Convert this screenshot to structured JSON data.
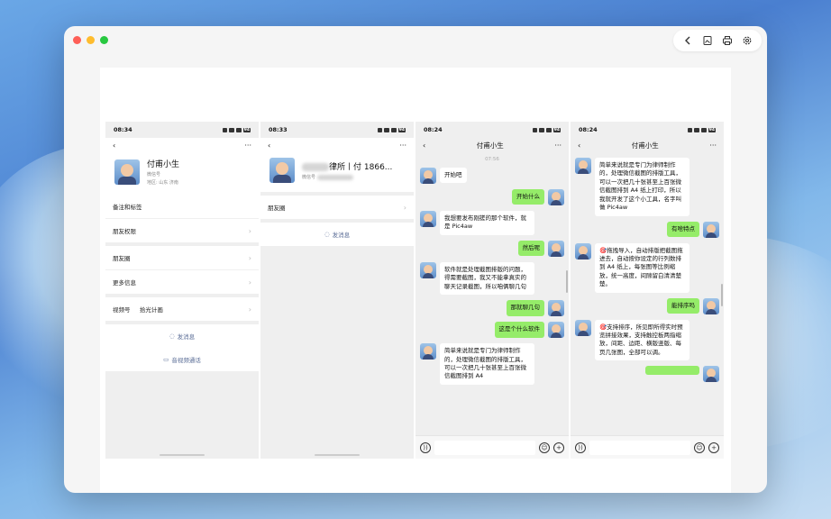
{
  "window": {
    "toolbar_icons": [
      "back-icon",
      "image-icon",
      "print-icon",
      "settings-icon"
    ]
  },
  "phones": [
    {
      "time": "08:34",
      "battery": "94",
      "name": "付甫小生",
      "wechat_id_label": "微信号",
      "region_label": "地区: 山东 济南",
      "rows": [
        "备注和标签",
        "朋友权限",
        "朋友圈",
        "更多信息"
      ],
      "channel_label": "视频号",
      "channel_value": "拾光计画",
      "send_message": "发消息",
      "video_call": "音视频通话"
    },
    {
      "time": "08:33",
      "battery": "94",
      "name_visible": "律所丨付",
      "name_suffix": "1866...",
      "wechat_id_label": "微信号",
      "moments": "朋友圈",
      "send_message": "发消息"
    },
    {
      "time": "08:24",
      "battery": "94",
      "title": "付甫小生",
      "timestamp": "07:56",
      "messages": [
        {
          "side": "left",
          "text": "开始吧"
        },
        {
          "side": "right",
          "text": "开始什么"
        },
        {
          "side": "left",
          "text": "我想要发布刚搓的那个软件，就是 Pic4aw"
        },
        {
          "side": "right",
          "text": "然后呢"
        },
        {
          "side": "left",
          "text": "软件就是处理截图排版的问题，得需要截图，我又不能拿真实的聊天记录截图，所以咱俩聊几句"
        },
        {
          "side": "right",
          "text": "那就聊几句"
        },
        {
          "side": "right",
          "text": "这是个什么软件"
        },
        {
          "side": "left",
          "text": "简单来说就是专门为律师制作的，处理微信截图的排版工具，可以一次把几十张甚至上百张微信截图排到 A4"
        }
      ]
    },
    {
      "time": "08:24",
      "battery": "94",
      "title": "付甫小生",
      "messages": [
        {
          "side": "left",
          "text": "简单来说就是专门为律师制作的，处理微信截图的排版工具，可以一次把几十张甚至上百张微信截图排到 A4 纸上打印，所以我就开发了这个小工具，名字叫做 Pic4aw"
        },
        {
          "side": "right",
          "text": "有啥特点"
        },
        {
          "side": "left",
          "text": "🎯拖拽导入，自动排版把截图拖进去，自动按你设定的行列数排到 A4 纸上，每张图等比例缩放，统一高度，间隙留白清清楚楚。"
        },
        {
          "side": "right",
          "text": "能排序吗"
        },
        {
          "side": "left",
          "text": "🎯支持排序，所见即所得实时预览拼接效果，支持触控板两指缩放，间距、边距、横版竖版、每页几张图，全部可以调。"
        },
        {
          "side": "right",
          "text": ""
        }
      ]
    }
  ]
}
